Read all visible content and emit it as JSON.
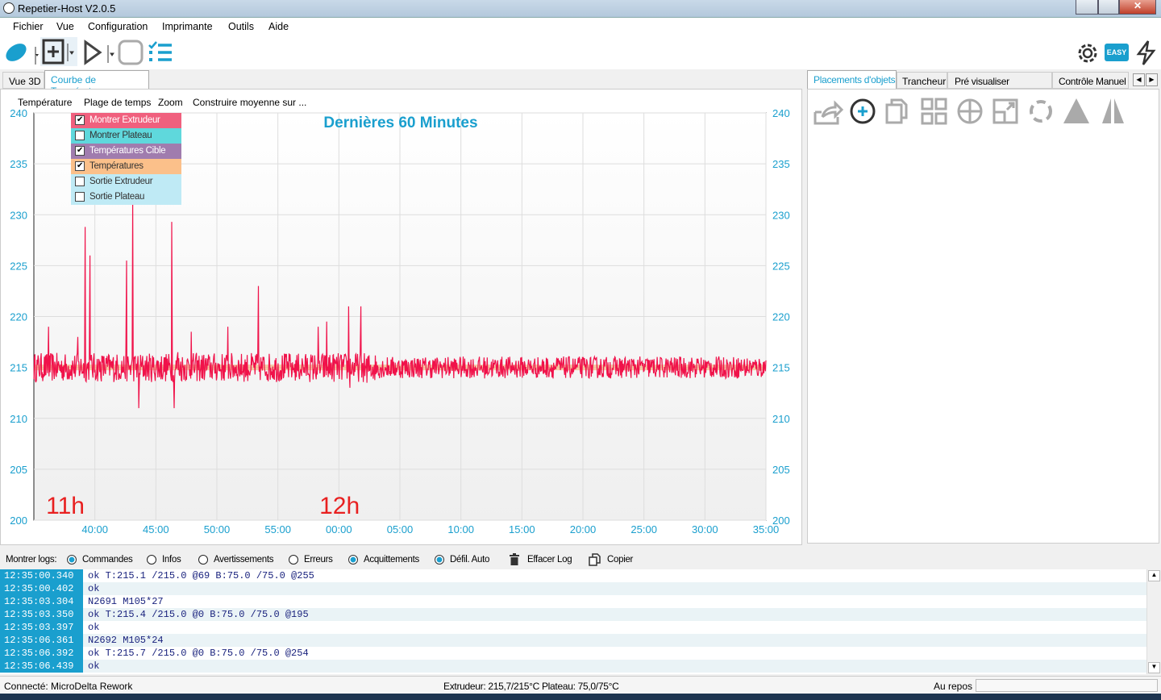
{
  "window": {
    "title": "Repetier-Host V2.0.5"
  },
  "menu": [
    "Fichier",
    "Vue",
    "Configuration",
    "Imprimante",
    "Outils",
    "Aide"
  ],
  "toolbar": {
    "easy_label": "EASY"
  },
  "left_tabs": [
    "Vue 3D",
    "Courbe de Température"
  ],
  "chart_menu": [
    "Température",
    "Plage de temps",
    "Zoom",
    "Construire moyenne sur ..."
  ],
  "right_tabs": [
    "Placements d'objets",
    "Trancheur",
    "Pré visualiser impression",
    "Contrôle Manuel"
  ],
  "legend": [
    {
      "label": "Montrer Extrudeur",
      "checked": true,
      "color": "#f0607e",
      "text": "#fff"
    },
    {
      "label": "Montrer Plateau",
      "checked": false,
      "color": "#5fd8dc",
      "text": "#333"
    },
    {
      "label": "Températures Cible",
      "checked": true,
      "color": "#a07cae",
      "text": "#fff"
    },
    {
      "label": "Températures",
      "checked": true,
      "color": "#fbc08a",
      "text": "#333"
    },
    {
      "label": "Sortie Extrudeur",
      "checked": false,
      "color": "#bfeaf5",
      "text": "#333"
    },
    {
      "label": "Sortie Plateau",
      "checked": false,
      "color": "#bfeaf5",
      "text": "#333"
    }
  ],
  "chart_data": {
    "type": "line",
    "title": "Dernières 60 Minutes",
    "xlim": [
      0,
      60
    ],
    "ylim": [
      200,
      240
    ],
    "yticks": [
      200,
      205,
      210,
      215,
      220,
      225,
      230,
      235,
      240
    ],
    "xticks": [
      {
        "v": 5,
        "label": "40:00"
      },
      {
        "v": 10,
        "label": "45:00"
      },
      {
        "v": 15,
        "label": "50:00"
      },
      {
        "v": 20,
        "label": "55:00"
      },
      {
        "v": 25,
        "label": "00:00"
      },
      {
        "v": 30,
        "label": "05:00"
      },
      {
        "v": 35,
        "label": "10:00"
      },
      {
        "v": 40,
        "label": "15:00"
      },
      {
        "v": 45,
        "label": "20:00"
      },
      {
        "v": 50,
        "label": "25:00"
      },
      {
        "v": 55,
        "label": "30:00"
      },
      {
        "v": 60,
        "label": "35:00"
      }
    ],
    "hour_labels": [
      {
        "v": 1,
        "label": "11h"
      },
      {
        "v": 23.4,
        "label": "12h"
      }
    ],
    "target": 215,
    "baseline": 215,
    "noise": 1.2,
    "spikes": [
      [
        1.2,
        219
      ],
      [
        3.6,
        218
      ],
      [
        4.2,
        228.8
      ],
      [
        4.6,
        226
      ],
      [
        7.6,
        225.5
      ],
      [
        8.1,
        231.5
      ],
      [
        8.6,
        211
      ],
      [
        11.3,
        229.3
      ],
      [
        11.5,
        211
      ],
      [
        11.8,
        216.5
      ],
      [
        12.9,
        218.5
      ],
      [
        15.9,
        219
      ],
      [
        18.4,
        223
      ],
      [
        21.2,
        215.5
      ],
      [
        23.3,
        219
      ],
      [
        24,
        219.5
      ],
      [
        25.8,
        221
      ],
      [
        25.9,
        213
      ],
      [
        26.8,
        221
      ],
      [
        27.3,
        213.5
      ]
    ],
    "series_color": "#f0124a",
    "target_color": "#f5b070"
  },
  "log_bar": {
    "label": "Montrer logs:",
    "options": [
      {
        "label": "Commandes",
        "on": true
      },
      {
        "label": "Infos",
        "on": false
      },
      {
        "label": "Avertissements",
        "on": false
      },
      {
        "label": "Erreurs",
        "on": false
      },
      {
        "label": "Acquittements",
        "on": true
      },
      {
        "label": "Défil. Auto",
        "on": true
      }
    ],
    "clear": "Effacer Log",
    "copy": "Copier"
  },
  "log": [
    {
      "t": "12:35:00.340",
      "m": "ok T:215.1 /215.0 @69 B:75.0 /75.0 @255"
    },
    {
      "t": "12:35:00.402",
      "m": "ok"
    },
    {
      "t": "12:35:03.304",
      "m": "N2691 M105*27"
    },
    {
      "t": "12:35:03.350",
      "m": "ok T:215.4 /215.0 @0 B:75.0 /75.0 @195"
    },
    {
      "t": "12:35:03.397",
      "m": "ok"
    },
    {
      "t": "12:35:06.361",
      "m": "N2692 M105*24"
    },
    {
      "t": "12:35:06.392",
      "m": "ok T:215.7 /215.0 @0 B:75.0 /75.0 @254"
    },
    {
      "t": "12:35:06.439",
      "m": "ok"
    }
  ],
  "status": {
    "connection": "Connecté: MicroDelta Rework",
    "temps": "Extrudeur: 215,7/215°C Plateau: 75,0/75°C",
    "state": "Au repos"
  }
}
